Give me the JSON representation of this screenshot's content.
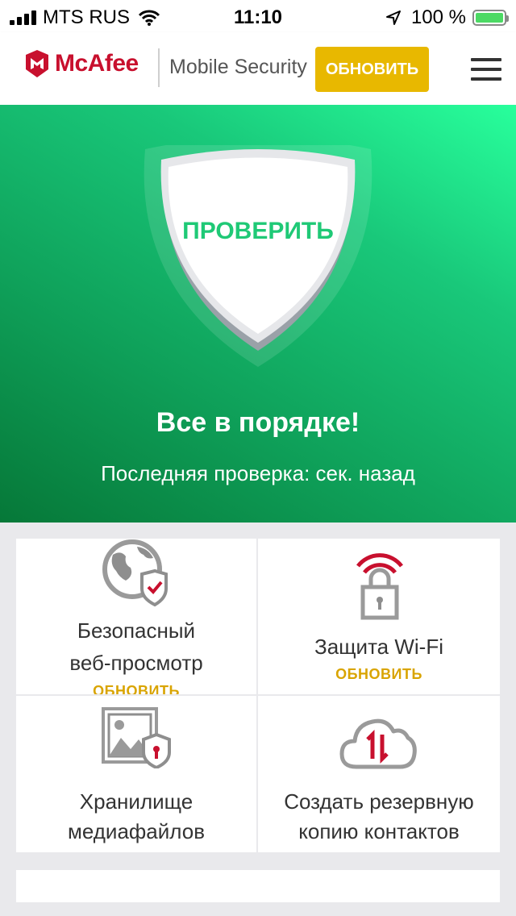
{
  "status_bar": {
    "carrier": "MTS RUS",
    "time": "11:10",
    "battery": "100 %",
    "battery_level": 1.0
  },
  "header": {
    "brand": "McAfee",
    "product": "Mobile Security",
    "upgrade_label": "ОБНОВИТЬ"
  },
  "hero": {
    "scan_label": "ПРОВЕРИТЬ",
    "status": "Все в порядке!",
    "last_scan": "Последняя проверка: сек. назад"
  },
  "tiles": [
    {
      "line1": "Безопасный",
      "line2": "веб-просмотр",
      "upgrade": "ОБНОВИТЬ",
      "icon": "globe-shield-icon"
    },
    {
      "line1": "Защита Wi-Fi",
      "upgrade": "ОБНОВИТЬ",
      "icon": "wifi-lock-icon"
    },
    {
      "line1": "Хранилище",
      "line2": "медиафайлов",
      "icon": "media-vault-icon"
    },
    {
      "line1": "Создать резервную",
      "line2": "копию контактов",
      "icon": "cloud-backup-icon"
    }
  ],
  "colors": {
    "brand_red": "#c8102e",
    "upgrade_yellow": "#e8b800",
    "hero_green": "#19c87a",
    "scan_green": "#1fc976"
  }
}
